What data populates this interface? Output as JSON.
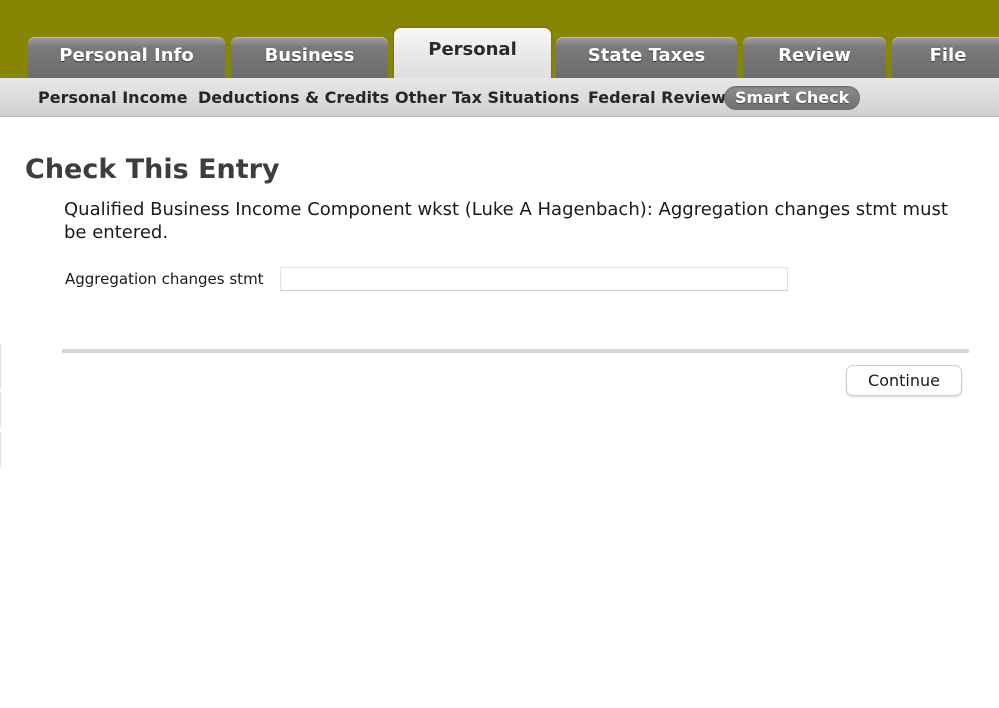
{
  "main_tabs": [
    {
      "label": "Personal Info",
      "active": false
    },
    {
      "label": "Business",
      "active": false
    },
    {
      "label": "Personal",
      "active": true
    },
    {
      "label": "State Taxes",
      "active": false
    },
    {
      "label": "Review",
      "active": false
    },
    {
      "label": "File",
      "active": false
    }
  ],
  "sub_nav": [
    {
      "label": "Personal Income",
      "active": false
    },
    {
      "label": "Deductions & Credits",
      "active": false
    },
    {
      "label": "Other Tax Situations",
      "active": false
    },
    {
      "label": "Federal Review",
      "active": false
    },
    {
      "label": "Smart Check",
      "active": true
    }
  ],
  "page": {
    "title": "Check This Entry",
    "message": "Qualified Business Income Component wkst (Luke A Hagenbach): Aggregation changes stmt must be entered."
  },
  "form": {
    "field_label": "Aggregation changes stmt",
    "field_value": "",
    "field_placeholder": ""
  },
  "actions": {
    "continue_label": "Continue"
  },
  "colors": {
    "top_band": "#868603",
    "tab_inactive": "#7a7a7a",
    "tab_active": "#e6e6e6",
    "sub_nav": "#dcdcdc",
    "smart_check_pill": "#7e7e7e"
  }
}
